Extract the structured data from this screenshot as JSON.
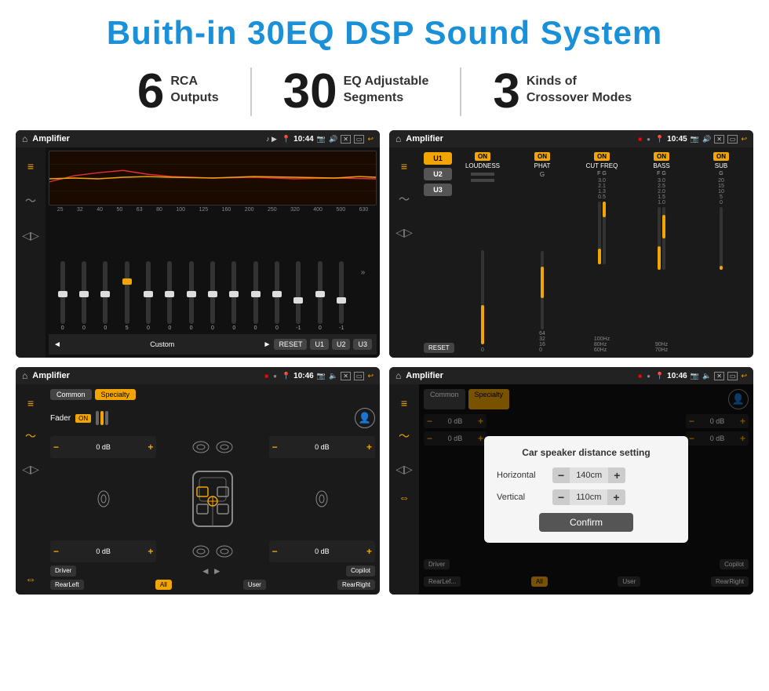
{
  "page": {
    "title": "Buith-in 30EQ DSP Sound System"
  },
  "stats": [
    {
      "number": "6",
      "label": "RCA\nOutputs"
    },
    {
      "number": "30",
      "label": "EQ Adjustable\nSegments"
    },
    {
      "number": "3",
      "label": "Kinds of\nCrossover Modes"
    }
  ],
  "screens": {
    "screen1": {
      "status": {
        "title": "Amplifier",
        "time": "10:44"
      },
      "freqs": [
        "25",
        "32",
        "40",
        "50",
        "63",
        "80",
        "100",
        "125",
        "160",
        "200",
        "250",
        "320",
        "400",
        "500",
        "630"
      ],
      "sliders": [
        "0",
        "0",
        "0",
        "5",
        "0",
        "0",
        "0",
        "0",
        "0",
        "0",
        "0",
        "-1",
        "0",
        "-1"
      ],
      "buttons": [
        "Custom",
        "RESET",
        "U1",
        "U2",
        "U3"
      ]
    },
    "screen2": {
      "status": {
        "title": "Amplifier",
        "time": "10:45"
      },
      "presets": [
        "U1",
        "U2",
        "U3"
      ],
      "channels": [
        "LOUDNESS",
        "PHAT",
        "CUT FREQ",
        "BASS",
        "SUB"
      ],
      "reset_label": "RESET"
    },
    "screen3": {
      "status": {
        "title": "Amplifier",
        "time": "10:46"
      },
      "tabs": [
        "Common",
        "Specialty"
      ],
      "fader_label": "Fader",
      "fader_on": "ON",
      "vol_values": [
        "0 dB",
        "0 dB",
        "0 dB",
        "0 dB"
      ],
      "buttons": {
        "driver": "Driver",
        "copilot": "Copilot",
        "rear_left": "RearLeft",
        "all": "All",
        "user": "User",
        "rear_right": "RearRight"
      }
    },
    "screen4": {
      "status": {
        "title": "Amplifier",
        "time": "10:46"
      },
      "tabs": [
        "Common",
        "Specialty"
      ],
      "dialog": {
        "title": "Car speaker distance setting",
        "horizontal_label": "Horizontal",
        "horizontal_value": "140cm",
        "vertical_label": "Vertical",
        "vertical_value": "110cm",
        "confirm_label": "Confirm"
      },
      "buttons": {
        "driver": "Driver",
        "copilot": "Copilot",
        "rear_left": "RearLef...",
        "all": "All",
        "user": "User",
        "rear_right": "RearRight"
      }
    }
  }
}
